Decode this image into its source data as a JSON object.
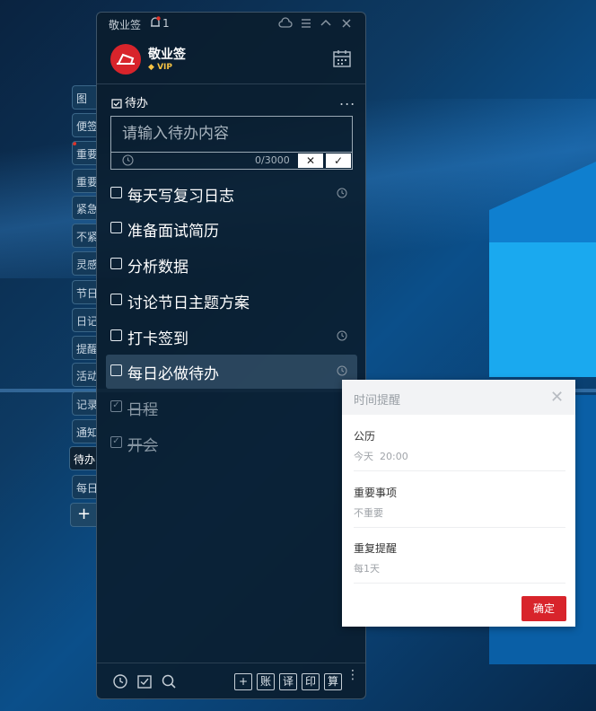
{
  "app": {
    "title": "敬业签",
    "notification_count": "1"
  },
  "user": {
    "name": "敬业签",
    "vip_label": "VIP"
  },
  "section": {
    "title": "待办",
    "more": "..."
  },
  "input": {
    "placeholder": "请输入待办内容",
    "counter": "0/3000",
    "cancel": "✕",
    "confirm": "✓"
  },
  "todos": [
    {
      "text": "每天写复习日志",
      "done": false,
      "alarm": true
    },
    {
      "text": "准备面试简历",
      "done": false,
      "alarm": false
    },
    {
      "text": "分析数据",
      "done": false,
      "alarm": false
    },
    {
      "text": "讨论节日主题方案",
      "done": false,
      "alarm": false
    },
    {
      "text": "打卡签到",
      "done": false,
      "alarm": true
    },
    {
      "text": "每日必做待办",
      "done": false,
      "alarm": true,
      "highlighted": true
    },
    {
      "text": "日程",
      "done": true,
      "alarm": false
    },
    {
      "text": "开会",
      "done": true,
      "alarm": false
    }
  ],
  "side_tabs": [
    "图",
    "便签",
    "重要",
    "重要",
    "紧急",
    "不紧",
    "灵感",
    "节日",
    "日记",
    "提醒",
    "活动",
    "记录",
    "通知",
    "待办",
    "每日"
  ],
  "side_add": "+",
  "footer": {
    "buttons": [
      "+",
      "账",
      "译",
      "印",
      "算"
    ],
    "more": "⋮"
  },
  "popup": {
    "title": "时间提醒",
    "close": "✕",
    "rows": [
      {
        "label": "公历",
        "value": "今天  20:00"
      },
      {
        "label": "重要事项",
        "value": "不重要"
      },
      {
        "label": "重复提醒",
        "value": "每1天"
      }
    ],
    "confirm": "确定"
  },
  "colors": {
    "accent": "#d8242b",
    "window_bg": "#0a1c2c",
    "vip": "#f6c343"
  }
}
